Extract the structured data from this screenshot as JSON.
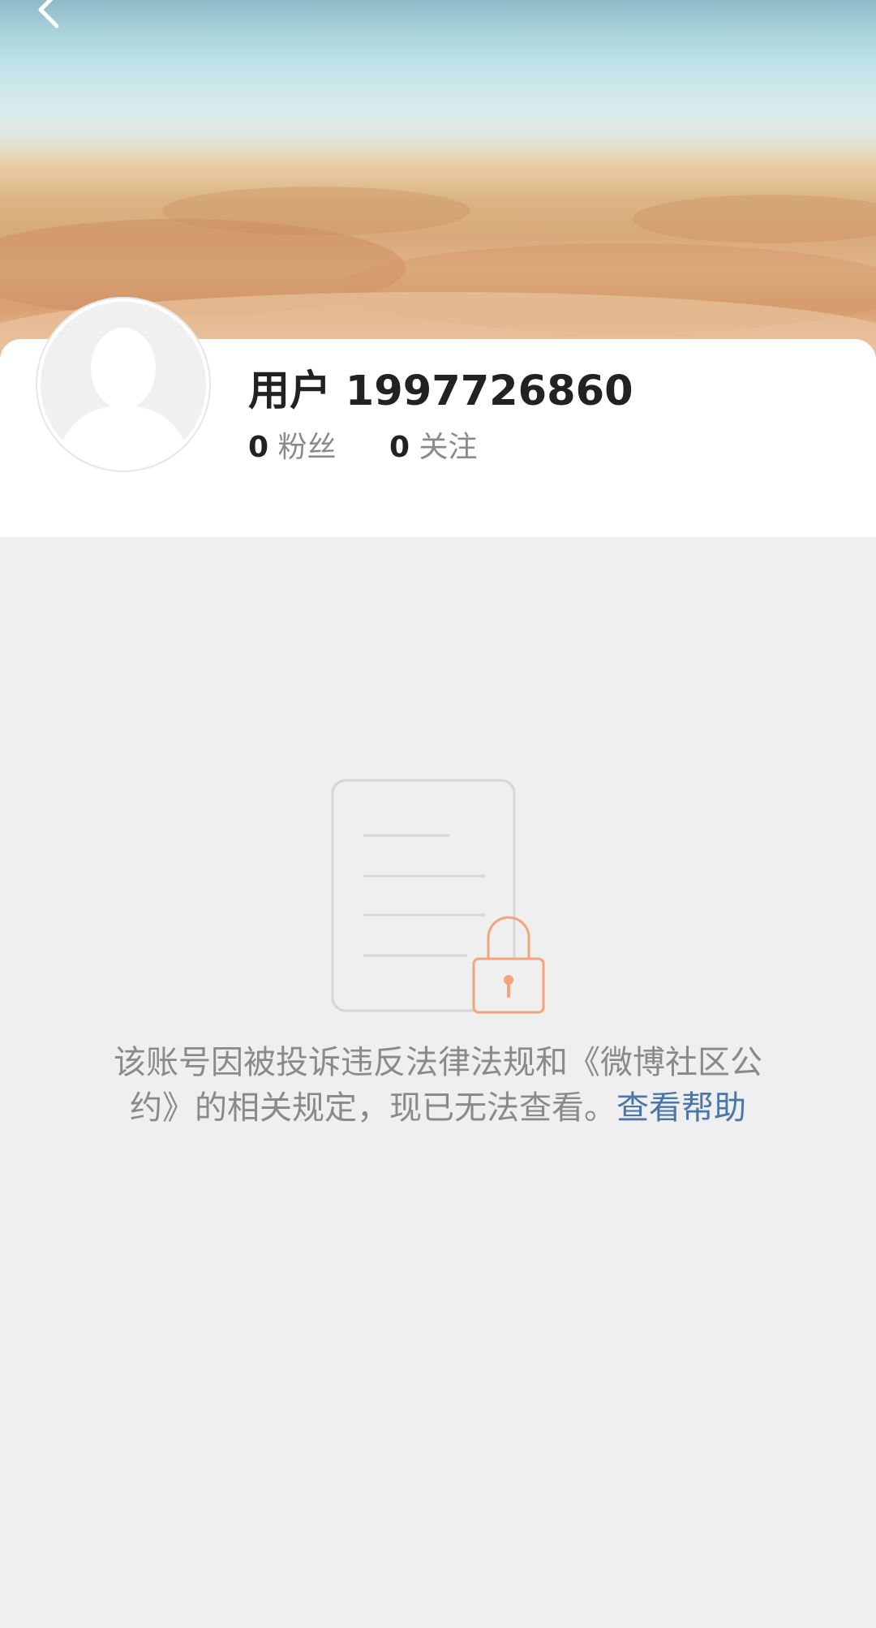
{
  "profile": {
    "username": "用户 1997726860",
    "followers_count": "0",
    "followers_label": "粉丝",
    "following_count": "0",
    "following_label": "关注"
  },
  "notice": {
    "text": "该账号因被投诉违反法律法规和《微博社区公约》的相关规定，现已无法查看。",
    "help_link": "查看帮助"
  },
  "icons": {
    "back": "chevron-left-icon",
    "avatar": "default-avatar-icon",
    "illustration": "locked-document-icon"
  },
  "colors": {
    "link": "#4a76a8",
    "lock": "#f2a57a",
    "text_muted": "#8a8a8a"
  }
}
